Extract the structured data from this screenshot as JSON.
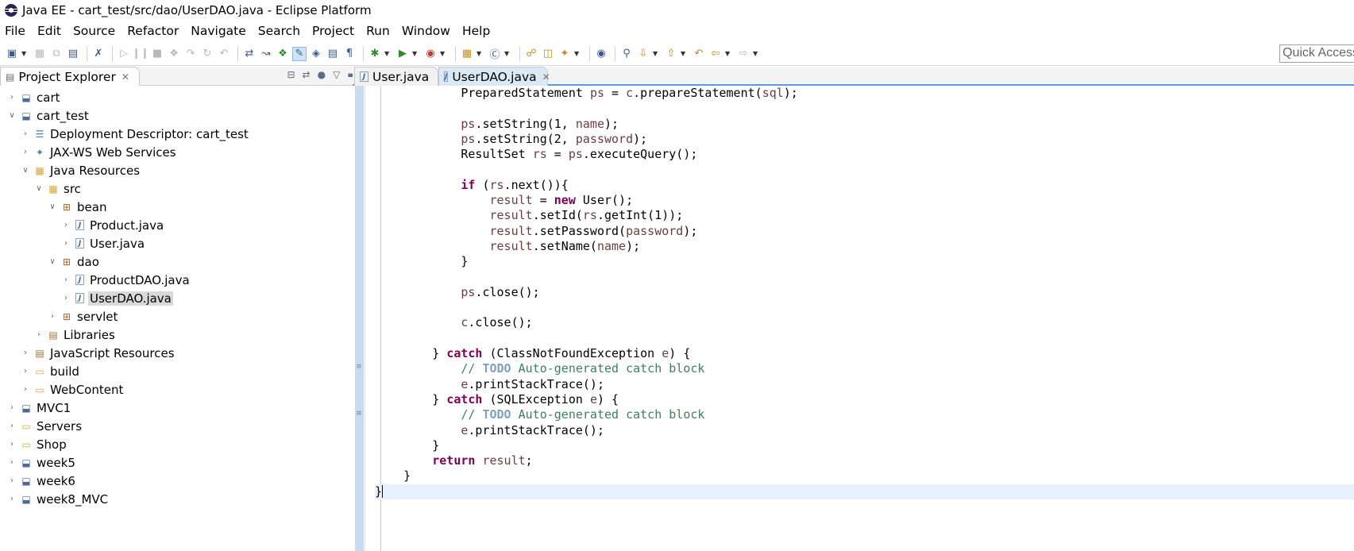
{
  "window": {
    "title": "Java EE - cart_test/src/dao/UserDAO.java - Eclipse Platform"
  },
  "menu": [
    "File",
    "Edit",
    "Source",
    "Refactor",
    "Navigate",
    "Search",
    "Project",
    "Run",
    "Window",
    "Help"
  ],
  "toolbar": {
    "quick_access_placeholder": "Quick Access"
  },
  "explorer": {
    "title": "Project Explorer",
    "tree": [
      {
        "label": "cart",
        "depth": 0,
        "expanded": false,
        "icon": "project-icon"
      },
      {
        "label": "cart_test",
        "depth": 0,
        "expanded": true,
        "icon": "project-icon"
      },
      {
        "label": "Deployment Descriptor: cart_test",
        "depth": 1,
        "expanded": false,
        "icon": "deployment-descriptor-icon"
      },
      {
        "label": "JAX-WS Web Services",
        "depth": 1,
        "expanded": false,
        "icon": "web-services-icon"
      },
      {
        "label": "Java Resources",
        "depth": 1,
        "expanded": true,
        "icon": "java-resources-icon"
      },
      {
        "label": "src",
        "depth": 2,
        "expanded": true,
        "icon": "source-folder-icon"
      },
      {
        "label": "bean",
        "depth": 3,
        "expanded": true,
        "icon": "package-icon"
      },
      {
        "label": "Product.java",
        "depth": 4,
        "expanded": false,
        "icon": "java-file-icon"
      },
      {
        "label": "User.java",
        "depth": 4,
        "expanded": false,
        "icon": "java-file-icon"
      },
      {
        "label": "dao",
        "depth": 3,
        "expanded": true,
        "icon": "package-icon"
      },
      {
        "label": "ProductDAO.java",
        "depth": 4,
        "expanded": false,
        "icon": "java-file-icon"
      },
      {
        "label": "UserDAO.java",
        "depth": 4,
        "expanded": false,
        "icon": "java-file-icon",
        "selected": true
      },
      {
        "label": "servlet",
        "depth": 3,
        "expanded": false,
        "icon": "package-icon"
      },
      {
        "label": "Libraries",
        "depth": 2,
        "expanded": false,
        "icon": "libraries-icon"
      },
      {
        "label": "JavaScript Resources",
        "depth": 1,
        "expanded": false,
        "icon": "javascript-resources-icon"
      },
      {
        "label": "build",
        "depth": 1,
        "expanded": false,
        "icon": "folder-icon"
      },
      {
        "label": "WebContent",
        "depth": 1,
        "expanded": false,
        "icon": "folder-icon"
      },
      {
        "label": "MVC1",
        "depth": 0,
        "expanded": false,
        "icon": "project-icon"
      },
      {
        "label": "Servers",
        "depth": 0,
        "expanded": false,
        "icon": "folder-icon"
      },
      {
        "label": "Shop",
        "depth": 0,
        "expanded": false,
        "icon": "folder-icon"
      },
      {
        "label": "week5",
        "depth": 0,
        "expanded": false,
        "icon": "project-icon"
      },
      {
        "label": "week6",
        "depth": 0,
        "expanded": false,
        "icon": "project-icon"
      },
      {
        "label": "week8_MVC",
        "depth": 0,
        "expanded": false,
        "icon": "project-icon"
      }
    ]
  },
  "editor": {
    "tabs": [
      {
        "label": "User.java",
        "active": false
      },
      {
        "label": "UserDAO.java",
        "active": true
      }
    ],
    "lines": [
      [
        [
          "",
          "            PreparedStatement "
        ],
        [
          "var",
          "ps"
        ],
        [
          "",
          " = "
        ],
        [
          "var",
          "c"
        ],
        [
          "",
          ".prepareStatement("
        ],
        [
          "var",
          "sql"
        ],
        [
          "",
          ");"
        ]
      ],
      [],
      [
        [
          "",
          "            "
        ],
        [
          "var",
          "ps"
        ],
        [
          "",
          ".setString(1, "
        ],
        [
          "var",
          "name"
        ],
        [
          "",
          ");"
        ]
      ],
      [
        [
          "",
          "            "
        ],
        [
          "var",
          "ps"
        ],
        [
          "",
          ".setString(2, "
        ],
        [
          "var",
          "password"
        ],
        [
          "",
          ");"
        ]
      ],
      [
        [
          "",
          "            ResultSet "
        ],
        [
          "var",
          "rs"
        ],
        [
          "",
          " = "
        ],
        [
          "var",
          "ps"
        ],
        [
          "",
          ".executeQuery();"
        ]
      ],
      [],
      [
        [
          "",
          "            "
        ],
        [
          "kw",
          "if"
        ],
        [
          "",
          " ("
        ],
        [
          "var",
          "rs"
        ],
        [
          "",
          ".next()){"
        ]
      ],
      [
        [
          "",
          "                "
        ],
        [
          "var",
          "result"
        ],
        [
          "",
          " = "
        ],
        [
          "kw",
          "new"
        ],
        [
          "",
          " User();"
        ]
      ],
      [
        [
          "",
          "                "
        ],
        [
          "var",
          "result"
        ],
        [
          "",
          ".setId("
        ],
        [
          "var",
          "rs"
        ],
        [
          "",
          ".getInt(1));"
        ]
      ],
      [
        [
          "",
          "                "
        ],
        [
          "var",
          "result"
        ],
        [
          "",
          ".setPassword("
        ],
        [
          "var",
          "password"
        ],
        [
          "",
          ");"
        ]
      ],
      [
        [
          "",
          "                "
        ],
        [
          "var",
          "result"
        ],
        [
          "",
          ".setName("
        ],
        [
          "var",
          "name"
        ],
        [
          "",
          ");"
        ]
      ],
      [
        [
          "",
          "            }"
        ]
      ],
      [],
      [
        [
          "",
          "            "
        ],
        [
          "var",
          "ps"
        ],
        [
          "",
          ".close();"
        ]
      ],
      [],
      [
        [
          "",
          "            "
        ],
        [
          "var",
          "c"
        ],
        [
          "",
          ".close();"
        ]
      ],
      [],
      [
        [
          "",
          "        } "
        ],
        [
          "kw",
          "catch"
        ],
        [
          "",
          " (ClassNotFoundException "
        ],
        [
          "var",
          "e"
        ],
        [
          "",
          ") {"
        ]
      ],
      [
        [
          "",
          "            "
        ],
        [
          "cm",
          "// "
        ],
        [
          "todo",
          "TODO"
        ],
        [
          "cm",
          " Auto-generated catch block"
        ]
      ],
      [
        [
          "",
          "            "
        ],
        [
          "var",
          "e"
        ],
        [
          "",
          ".printStackTrace();"
        ]
      ],
      [
        [
          "",
          "        } "
        ],
        [
          "kw",
          "catch"
        ],
        [
          "",
          " (SQLException "
        ],
        [
          "var",
          "e"
        ],
        [
          "",
          ") {"
        ]
      ],
      [
        [
          "",
          "            "
        ],
        [
          "cm",
          "// "
        ],
        [
          "todo",
          "TODO"
        ],
        [
          "cm",
          " Auto-generated catch block"
        ]
      ],
      [
        [
          "",
          "            "
        ],
        [
          "var",
          "e"
        ],
        [
          "",
          ".printStackTrace();"
        ]
      ],
      [
        [
          "",
          "        }"
        ]
      ],
      [
        [
          "",
          "        "
        ],
        [
          "kw",
          "return"
        ],
        [
          "",
          " "
        ],
        [
          "var",
          "result"
        ],
        [
          "",
          ";"
        ]
      ],
      [
        [
          "",
          "    }"
        ]
      ],
      [
        [
          "",
          "}"
        ]
      ]
    ]
  }
}
